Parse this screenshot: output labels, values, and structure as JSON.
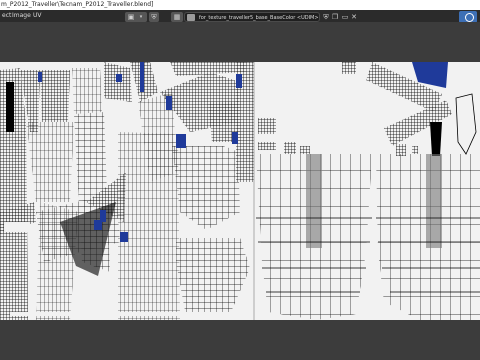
{
  "window": {
    "title": "m_P2012_Traveller\\Tecnam_P2012_Traveller.blend]"
  },
  "menu": [
    {
      "label": "ect"
    },
    {
      "label": "Image"
    },
    {
      "label": "UV"
    }
  ],
  "image": {
    "name": "for_texture_traveller5_base_BaseColor <UDIM>.png"
  },
  "colors": {
    "accent": "#1f3a9a",
    "wire": "#000000",
    "canvas": "#f2f2f2",
    "chrome_dark": "#3c3c3c",
    "gizmo": "#3d6fb5"
  },
  "icons": [
    "view-icon",
    "shield-icon",
    "image-icon",
    "fake-user-icon",
    "new-image-icon",
    "open-folder-icon",
    "close-icon",
    "navigation-gizmo"
  ]
}
